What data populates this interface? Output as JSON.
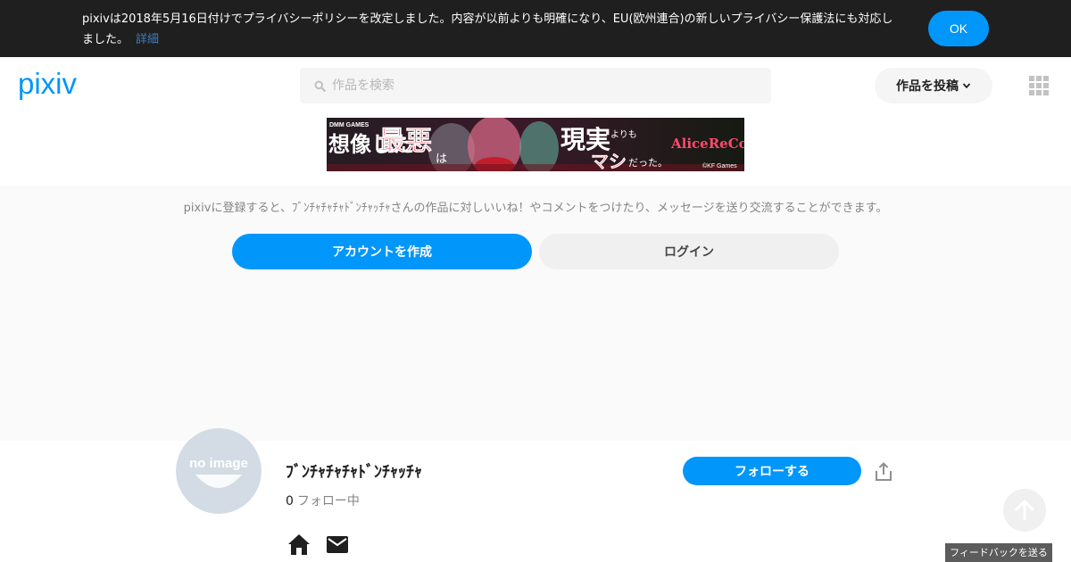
{
  "notice": {
    "text": "pixivは2018年5月16日付けでプライバシーポリシーを改定しました。内容が以前よりも明確になり、EU(欧州連合)の新しいプライバシー保護法にも対応しました。",
    "link_label": "詳細",
    "ok_label": "OK"
  },
  "header": {
    "logo_text": "pixiv",
    "search_placeholder": "作品を検索",
    "post_label": "作品を投稿"
  },
  "banner": {
    "brand": "DMM GAMES",
    "headline_1": "想像した",
    "headline_bad": "最悪",
    "headline_2": "は",
    "headline_3": "現実",
    "headline_4": "よりも",
    "headline_5": "マシ",
    "headline_6": "だった。",
    "game_logo": "AliceReCode",
    "copyright": "©KF Games"
  },
  "signup": {
    "message": "pixivに登録すると、ﾌﾞﾝﾁｬﾁｬﾁｬﾄﾞﾝﾁｬｯﾁｬさんの作品に対しいいね！やコメントをつけたり、メッセージを送り交流することができます。",
    "create_label": "アカウントを作成",
    "login_label": "ログイン"
  },
  "profile": {
    "avatar_text": "no image",
    "username": "ﾌﾞﾝﾁｬﾁｬﾁｬﾄﾞﾝﾁｬｯﾁｬ",
    "following_count": "0",
    "following_label": "フォロー中",
    "follow_label": "フォローする"
  },
  "feedback_label": "フィードバックを送る",
  "colors": {
    "accent": "#0096fa",
    "notice_bg": "#1f1f1f",
    "link": "#3d7fc1"
  },
  "icons": [
    "search-icon",
    "chevron-down-icon",
    "apps-grid-icon",
    "share-icon",
    "home-icon",
    "mail-icon",
    "arrow-up-icon"
  ]
}
